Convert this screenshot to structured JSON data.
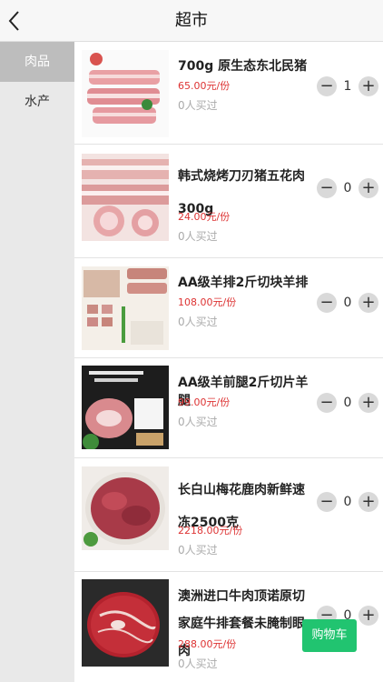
{
  "header": {
    "title": "超市"
  },
  "sidebar": {
    "categories": [
      {
        "label": "肉品"
      },
      {
        "label": "水产"
      }
    ]
  },
  "products": [
    {
      "name": "700g 原生态东北民猪",
      "price": "65.00元/份",
      "buyers": "0人买过",
      "qty": "1",
      "minus": "−",
      "plus": "+",
      "image": "pork-belly-slab"
    },
    {
      "name": "韩式烧烤刀刃猪五花肉300g",
      "price": "24.00元/份",
      "buyers": "0人买过",
      "qty": "0",
      "minus": "−",
      "plus": "+",
      "image": "pork-belly-rolls"
    },
    {
      "name": "AA级羊排2斤切块羊排",
      "price": "108.00元/份",
      "buyers": "0人买过",
      "qty": "0",
      "minus": "−",
      "plus": "+",
      "image": "lamb-ribs"
    },
    {
      "name": "AA级羊前腿2斤切片羊腿",
      "price": "99.00元/份",
      "buyers": "0人买过",
      "qty": "0",
      "minus": "−",
      "plus": "+",
      "image": "lamb-leg-slices"
    },
    {
      "name": "长白山梅花鹿肉新鲜速冻2500克",
      "price": "2218.00元/份",
      "buyers": "0人买过",
      "qty": "0",
      "minus": "−",
      "plus": "+",
      "image": "venison"
    },
    {
      "name": "澳洲进口牛肉顶诺原切家庭牛排套餐未腌制眼肉",
      "price": "288.00元/份",
      "buyers": "0人买过",
      "qty": "0",
      "minus": "−",
      "plus": "+",
      "image": "beef-steak"
    }
  ],
  "cart": {
    "label": "购物车"
  },
  "colors": {
    "price": "#dd3333",
    "cart": "#21c470",
    "active_category": "#bdbdbd"
  }
}
